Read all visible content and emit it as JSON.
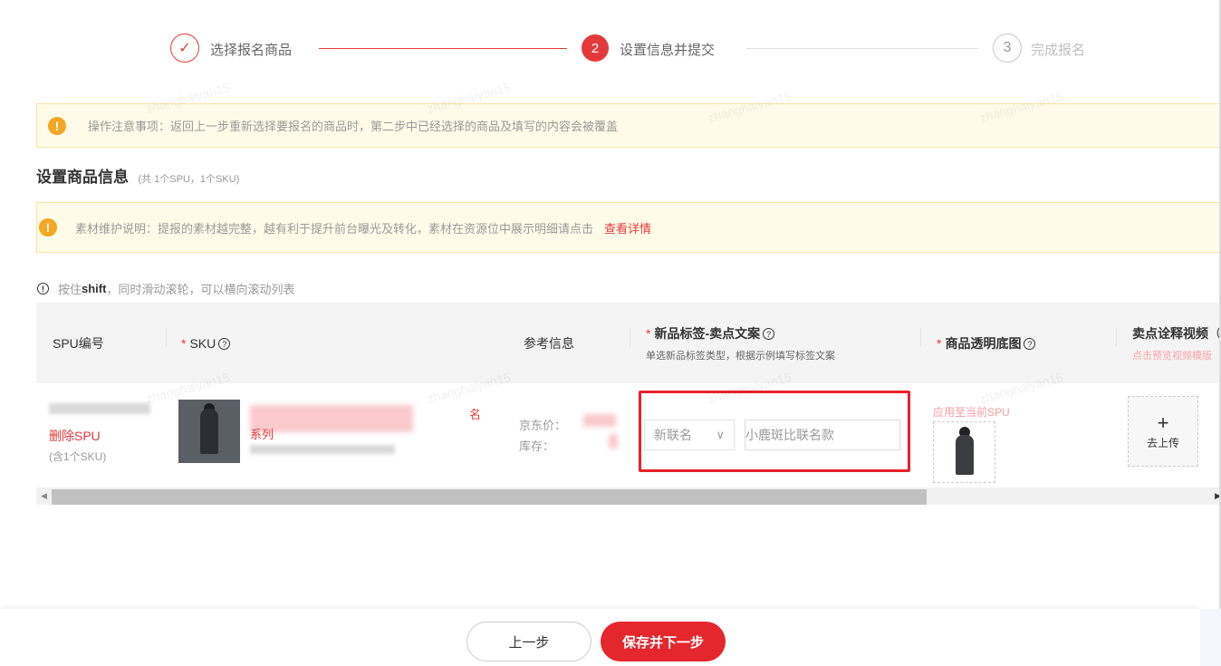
{
  "steps": [
    {
      "number": "✓",
      "label": "选择报名商品"
    },
    {
      "number": "2",
      "label": "设置信息并提交"
    },
    {
      "number": "3",
      "label": "完成报名"
    }
  ],
  "notice1": {
    "text": "操作注意事项：返回上一步重新选择要报名的商品时，第二步中已经选择的商品及填写的内容会被覆盖"
  },
  "section": {
    "title": "设置商品信息",
    "subtitle": "(共 1个SPU，1个SKU)"
  },
  "notice2": {
    "text": "素材维护说明：提报的素材越完整，越有利于提升前台曝光及转化，素材在资源位中展示明细请点击",
    "link": "查看详情"
  },
  "tip": {
    "prefix": "按住",
    "key": "shift",
    "suffix": "，同时滑动滚轮，可以横向滚动列表"
  },
  "table": {
    "headers": {
      "spu": "SPU编号",
      "sku": "SKU",
      "ref": "参考信息",
      "tag": "新品标签-卖点文案",
      "tag_sub": "单选新品标签类型，根据示例填写标签文案",
      "img": "商品透明底图",
      "video": "卖点诠释视频",
      "video_sub": "点击预览视频模版"
    },
    "row": {
      "spu_delete": "删除SPU",
      "spu_count": "(含1个SKU)",
      "sku_title_suffix": "名",
      "sku_title_line2": "系列",
      "ref_price_label": "京东价：",
      "ref_stock_label": "库存：",
      "tag_select": "新联名",
      "tag_input_value": "小鹿斑比联名款",
      "apply_link": "应用至当前SPU",
      "upload_label": "去上传"
    }
  },
  "footer": {
    "prev": "上一步",
    "next": "保存并下一步"
  },
  "watermark": "zhanghaiyan15",
  "colors": {
    "accent": "#e4393c",
    "warning": "#f5a623",
    "notice_bg": "#fffbe8"
  }
}
